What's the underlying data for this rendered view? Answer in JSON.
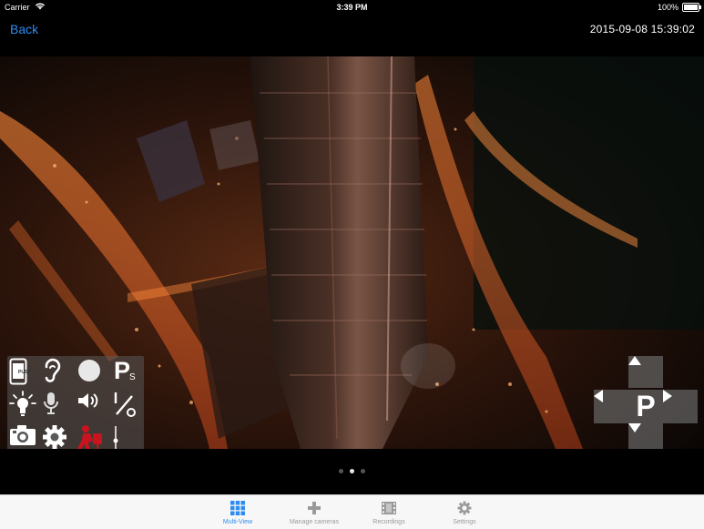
{
  "status_bar": {
    "carrier": "Carrier",
    "time": "3:39 PM",
    "battery": "100%",
    "battery_level": 1.0
  },
  "nav": {
    "back_label": "Back",
    "datetime": "2015-09-08 15:39:02"
  },
  "controls": {
    "push_label": "PUSH",
    "preset_badge": "P",
    "preset_sub": "S",
    "icons": [
      "push-notification-icon",
      "listen-ear-icon",
      "record-icon",
      "preset-set-icon",
      "light-bulb-icon",
      "microphone-icon",
      "speaker-volume-icon",
      "divider-slash-icon",
      "camera-snapshot-icon",
      "settings-gear-icon",
      "motion-alarm-icon",
      "slider-icon"
    ]
  },
  "ptz": {
    "center_label": "P"
  },
  "pager": {
    "count": 3,
    "active_index": 1
  },
  "tabbar": {
    "tabs": [
      {
        "label": "Multi-View",
        "icon": "grid-icon",
        "active": true
      },
      {
        "label": "Manage cameras",
        "icon": "plus-icon",
        "active": false
      },
      {
        "label": "Recordings",
        "icon": "film-icon",
        "active": false
      },
      {
        "label": "Settings",
        "icon": "gear-icon",
        "active": false
      }
    ]
  },
  "colors": {
    "accent": "#2e8bf0",
    "alarm_red": "#c8141e"
  }
}
